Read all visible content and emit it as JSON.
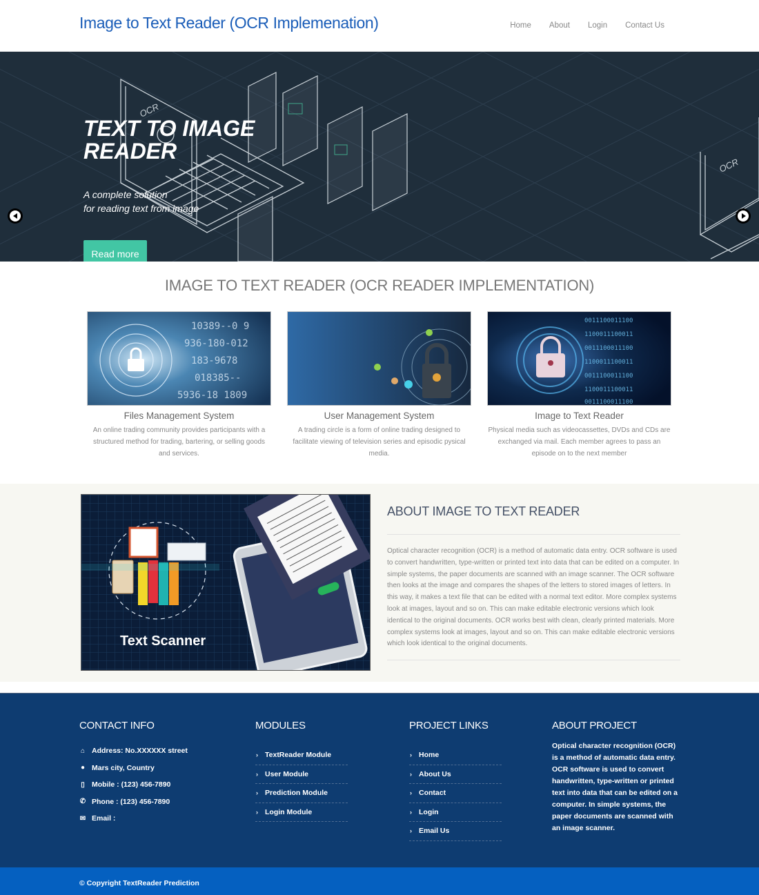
{
  "header": {
    "brand": "Image to Text Reader (OCR Implemenation)",
    "nav": [
      "Home",
      "About",
      "Login",
      "Contact Us"
    ]
  },
  "hero": {
    "title": "TEXT TO IMAGE READER",
    "subtitle_line1": "A complete solution",
    "subtitle_line2": "for reading text from image",
    "button": "Read more",
    "slide_count": 3,
    "active_slide": 1,
    "illustration_label": "OCR"
  },
  "features": {
    "heading": "IMAGE TO TEXT READER (OCR READER IMPLEMENTATION)",
    "cards": [
      {
        "title": "Files Management System",
        "text": "An online trading community provides participants with a structured method for trading, bartering, or selling goods and services."
      },
      {
        "title": "User Management System",
        "text": "A trading circle is a form of online trading designed to facilitate viewing of television series and episodic pysical media."
      },
      {
        "title": "Image to Text Reader",
        "text": "Physical media such as videocassettes, DVDs and CDs are exchanged via mail. Each member agrees to pass an episode on to the next member"
      }
    ]
  },
  "about": {
    "heading": "ABOUT IMAGE TO TEXT READER",
    "image_caption": "Text Scanner",
    "text": "Optical character recognition (OCR) is a method of automatic data entry. OCR software is used to convert handwritten, type-written or printed text into data that can be edited on a computer. In simple systems, the paper documents are scanned with an image scanner. The OCR software then looks at the image and compares the shapes of the letters to stored images of letters. In this way, it makes a text file that can be edited with a normal text editor. More complex systems look at images, layout and so on. This can make editable electronic versions which look identical to the original documents. OCR works best with clean, clearly printed materials. More complex systems look at images, layout and so on. This can make editable electronic versions which look identical to the original documents."
  },
  "footer": {
    "contact": {
      "heading": "CONTACT INFO",
      "items": [
        {
          "icon": "home-icon",
          "text": "Address: No.XXXXXX street"
        },
        {
          "icon": "globe-icon",
          "text": "Mars city, Country"
        },
        {
          "icon": "mobile-icon",
          "text": "Mobile : (123) 456-7890"
        },
        {
          "icon": "phone-icon",
          "text": "Phone : (123) 456-7890"
        },
        {
          "icon": "envelope-icon",
          "text": "Email :"
        }
      ]
    },
    "modules": {
      "heading": "MODULES",
      "items": [
        "TextReader Module",
        "User Module",
        "Prediction Module",
        "Login Module"
      ]
    },
    "project_links": {
      "heading": "PROJECT LINKS",
      "items": [
        "Home",
        "About Us",
        "Contact",
        "Login",
        "Email Us"
      ]
    },
    "about_project": {
      "heading": "ABOUT PROJECT",
      "text": "Optical character recognition (OCR) is a method of automatic data entry. OCR software is used to convert handwritten, type-written or printed text into data that can be edited on a computer. In simple systems, the paper documents are scanned with an image scanner."
    },
    "copyright": "© Copyright TextReader Prediction"
  },
  "colors": {
    "brand": "#1a5db8",
    "hero_bg": "#1f2e3b",
    "button": "#42c6a4",
    "footer_bg": "#0e3c71",
    "copyright_bg": "#0560c0",
    "about_bg": "#f7f7f2"
  }
}
